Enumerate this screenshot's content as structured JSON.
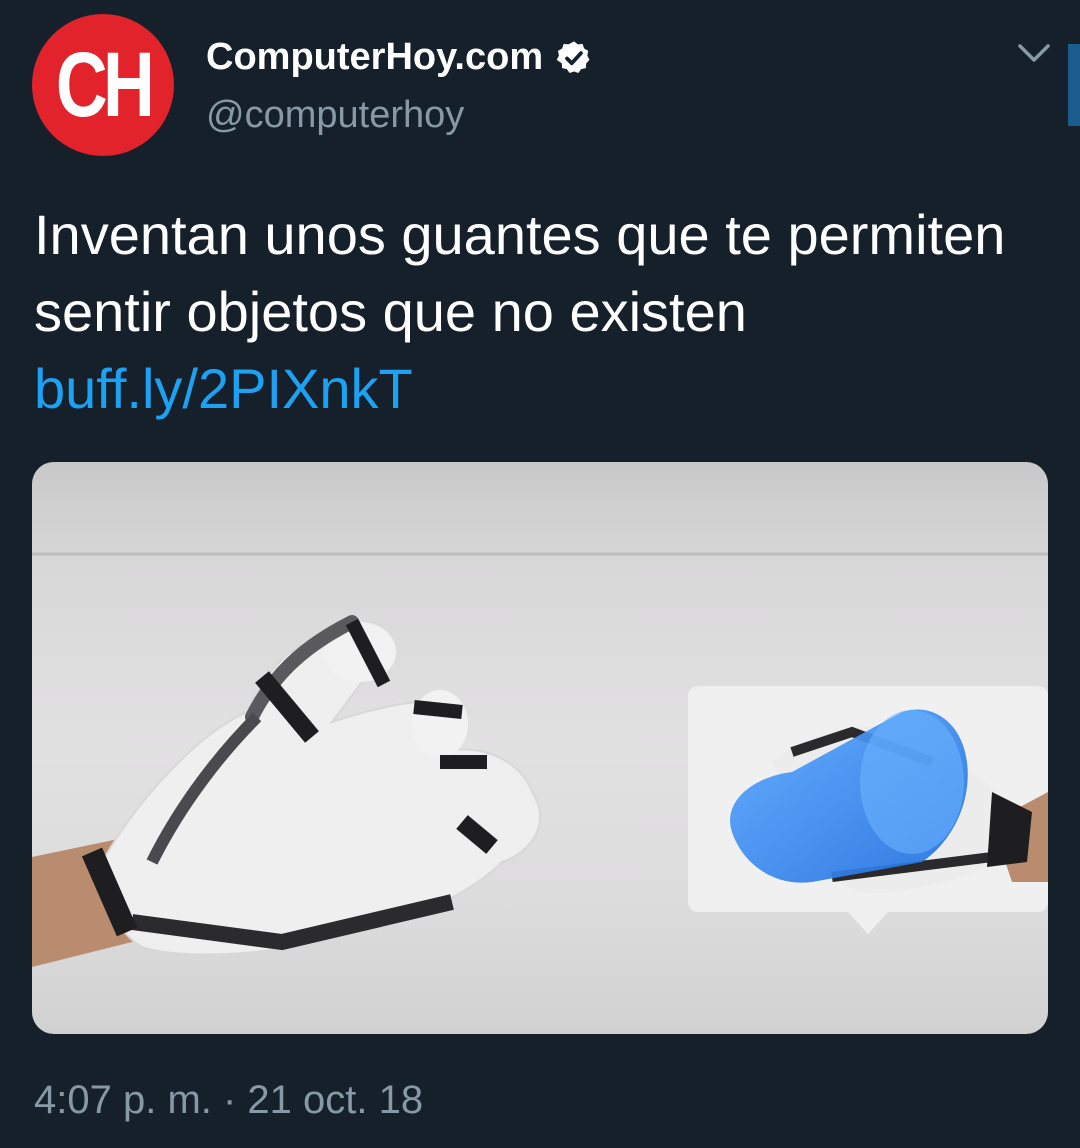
{
  "author": {
    "avatar_text": "CH",
    "display_name": "ComputerHoy.com",
    "handle": "@computerhoy",
    "verified": true,
    "verified_icon": "verified-badge-icon"
  },
  "menu_icon": "chevron-down-icon",
  "tweet": {
    "text": "Inventan unos guantes que te permiten sentir objetos que no existen ",
    "link": "buff.ly/2PIXnkT"
  },
  "media": {
    "description_icon": "photo-haptic-glove-with-virtual-cup"
  },
  "meta": {
    "timestamp": "4:07 p. m. · 21 oct. 18"
  },
  "colors": {
    "background": "#15202b",
    "text": "#ffffff",
    "secondary": "#8899a6",
    "link": "#1da1f2",
    "avatar_red": "#e3232b"
  }
}
